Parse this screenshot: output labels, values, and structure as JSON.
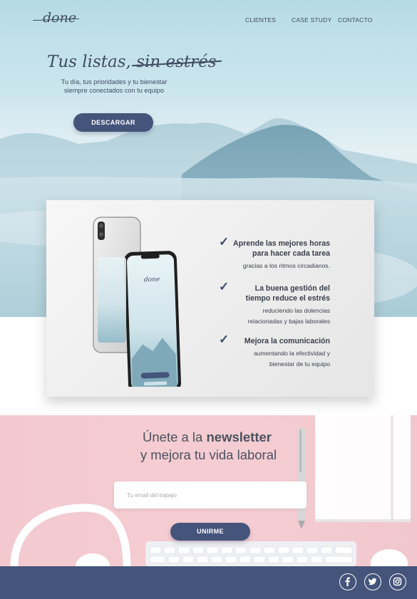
{
  "header": {
    "logo": "done",
    "nav": [
      "CLIENTES",
      "CASE STUDY",
      "CONTACTO"
    ]
  },
  "hero": {
    "title_plain": "Tus listas,",
    "title_struck": "sin estrés",
    "subtitle_line1": "Tu día, tus prioridades y tu bienestar",
    "subtitle_line2": "siempre conectados con tu equipo",
    "button": "DESCARGAR"
  },
  "features": [
    {
      "title_line1": "Aprende las mejores horas",
      "title_line2": "para hacer cada tarea",
      "desc_line1": "gracias a los ritmos circadianos.",
      "desc_line2": ""
    },
    {
      "title_line1": "La buena gestión del",
      "title_line2": "tiempo reduce el estrés",
      "desc_line1": "reduciendo las dolencias",
      "desc_line2": "relacionadas y bajas laborales"
    },
    {
      "title_line1": "Mejora la comunicación",
      "title_line2": "",
      "desc_line1": "aumentando la efectividad y",
      "desc_line2": "bienestar de tu equipo"
    }
  ],
  "phone_screen": {
    "logo": "done",
    "button": "DESCARGAR"
  },
  "newsletter": {
    "line1_prefix": "Únete a la",
    "line1_bold": "newsletter",
    "line2": "y mejora tu vida laboral",
    "email_placeholder": "Tu email del trabajo",
    "button": "UNIRME"
  },
  "footer": {
    "social": [
      "facebook-icon",
      "twitter-icon",
      "instagram-icon"
    ]
  },
  "colors": {
    "primary": "#44547a",
    "text": "#3f4b63",
    "pink": "#f3c9cf",
    "sky": "#b6dbe6"
  }
}
